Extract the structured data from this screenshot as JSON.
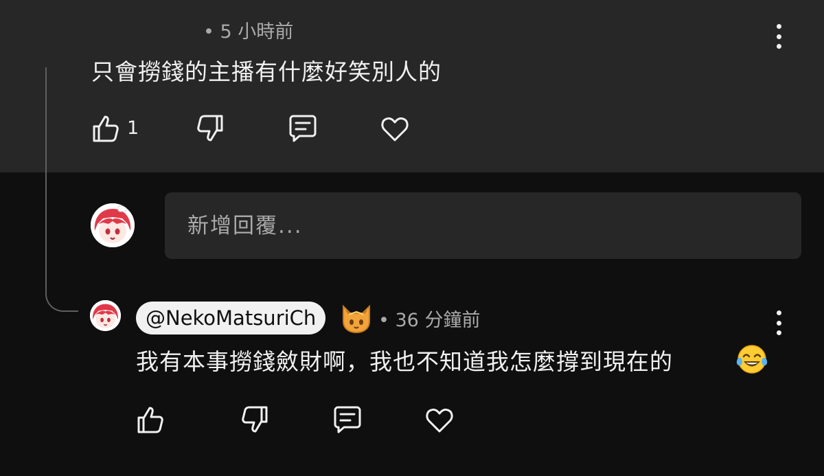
{
  "top_comment": {
    "meta": "• 5 小時前",
    "text": "只會撈錢的主播有什麼好笑別人的",
    "like_count": "1",
    "icons": [
      "like-icon",
      "dislike-icon",
      "reply-icon",
      "heart-icon",
      "more-options-icon"
    ]
  },
  "reply_box": {
    "placeholder": "新增回覆..."
  },
  "reply": {
    "author_handle": "@NekoMatsuriCh",
    "meta": "• 36 分鐘前",
    "text": "我有本事撈錢斂財啊，我也不知道我怎麼撐到現在的",
    "emoji": "face-with-tears-of-joy",
    "badge": "cat-member-badge",
    "icons": [
      "like-icon",
      "dislike-icon",
      "reply-icon",
      "heart-icon",
      "more-options-icon"
    ]
  },
  "colors": {
    "background": "#0f0f0f",
    "top_comment_bg": "#272727",
    "text": "#f1f1f1",
    "secondary_text": "#aaaaaa",
    "input_bg": "#272727",
    "avatar_hair": "#e03a4a"
  }
}
